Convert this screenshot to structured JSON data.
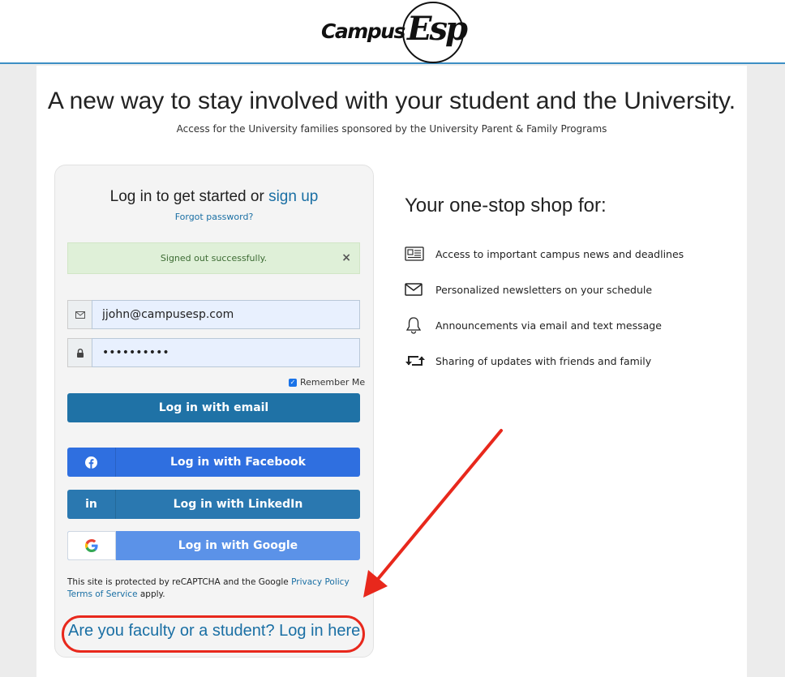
{
  "header": {
    "logo_word": "Campus",
    "logo_esp": "Esp"
  },
  "hero": {
    "headline": "A new way to stay involved with your student and the University.",
    "subline": "Access for the University families sponsored by the University Parent & Family Programs"
  },
  "login": {
    "title_prefix": "Log in to get started or ",
    "signup_link": "sign up",
    "forgot_link": "Forgot password?",
    "alert_text": "Signed out successfully.",
    "alert_close": "×",
    "email_value": "jjohn@campusesp.com",
    "password_value": "••••••••••",
    "remember_label": "Remember Me",
    "email_button": "Log in with email",
    "facebook_button": "Log in with Facebook",
    "linkedin_button": "Log in with LinkedIn",
    "linkedin_icon_text": "in",
    "google_button": "Log in with Google",
    "recaptcha_prefix": "This site is protected by reCAPTCHA and the Google ",
    "privacy_link": "Privacy Policy",
    "terms_link": "Terms of Service",
    "recaptcha_suffix": " apply.",
    "faculty_link": "Are you faculty or a student? Log in here"
  },
  "features": {
    "heading": "Your one-stop shop for:",
    "items": [
      {
        "icon": "newspaper-icon",
        "text": "Access to important campus news and deadlines"
      },
      {
        "icon": "envelope-icon",
        "text": "Personalized newsletters on your schedule"
      },
      {
        "icon": "bell-icon",
        "text": "Announcements via email and text message"
      },
      {
        "icon": "retweet-icon",
        "text": "Sharing of updates with friends and family"
      }
    ]
  },
  "colors": {
    "link": "#1a6fa4",
    "email_button": "#1f72a6",
    "facebook_button": "#2f6fe0",
    "linkedin_button": "#2a78b0",
    "google_button": "#5b92e8",
    "annotation": "#e8281c",
    "header_border": "#3d8fc4"
  }
}
